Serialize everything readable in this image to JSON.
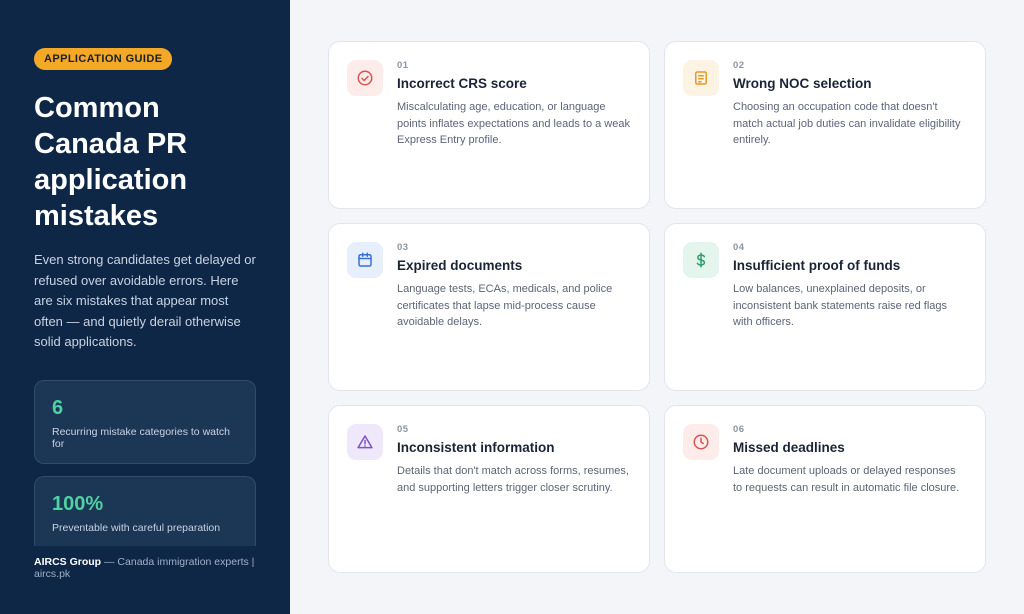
{
  "sidebar": {
    "badge": "APPLICATION GUIDE",
    "title": "Common Canada PR application mistakes",
    "intro": "Even strong candidates get delayed or refused over avoidable errors. Here are six mistakes that appear most often — and quietly derail otherwise solid applications.",
    "stats": [
      {
        "value": "6",
        "label": "Recurring mistake categories to watch for"
      },
      {
        "value": "100%",
        "label": "Preventable with careful preparation"
      }
    ],
    "footer_brand": "AIRCS Group",
    "footer_text": " — Canada immigration experts  |  aircs.pk"
  },
  "cards": [
    {
      "num": "01",
      "title": "Incorrect CRS score",
      "text": "Miscalculating age, education, or language points inflates expectations and leads to a weak Express Entry profile.",
      "icon": "check-circle-icon",
      "color": "#d9534f",
      "bg": "#fdecea"
    },
    {
      "num": "02",
      "title": "Wrong NOC selection",
      "text": "Choosing an occupation code that doesn't match actual job duties can invalidate eligibility entirely.",
      "icon": "document-icon",
      "color": "#e09b2d",
      "bg": "#fdf3e2"
    },
    {
      "num": "03",
      "title": "Expired documents",
      "text": "Language tests, ECAs, medicals, and police certificates that lapse mid-process cause avoidable delays.",
      "icon": "calendar-icon",
      "color": "#3b6fd4",
      "bg": "#e7effc"
    },
    {
      "num": "04",
      "title": "Insufficient proof of funds",
      "text": "Low balances, unexplained deposits, or inconsistent bank statements raise red flags with officers.",
      "icon": "dollar-icon",
      "color": "#2e9d6b",
      "bg": "#e4f5ed"
    },
    {
      "num": "05",
      "title": "Inconsistent information",
      "text": "Details that don't match across forms, resumes, and supporting letters trigger closer scrutiny.",
      "icon": "warning-icon",
      "color": "#7b52c7",
      "bg": "#efe8fa"
    },
    {
      "num": "06",
      "title": "Missed deadlines",
      "text": "Late document uploads or delayed responses to requests can result in automatic file closure.",
      "icon": "clock-icon",
      "color": "#d9534f",
      "bg": "#fdecea"
    }
  ]
}
